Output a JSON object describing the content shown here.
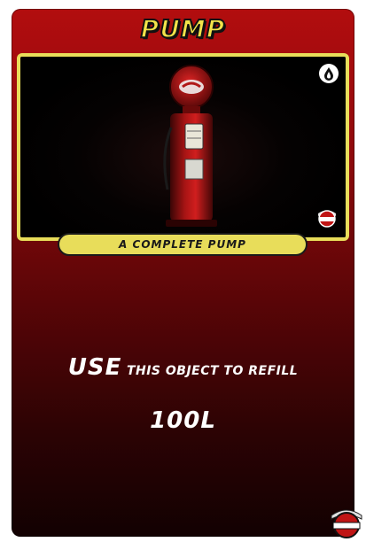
{
  "card": {
    "title": "PUMP",
    "caption": "A COMPLETE PUMP",
    "use_word": "USE",
    "use_rest": "THIS OBJECT TO REFILL",
    "amount": "100L"
  },
  "icons": {
    "top_right": "fuel-drop-icon",
    "image_logo": "world-logo-icon",
    "corner_logo": "world-logo-icon"
  },
  "colors": {
    "accent_yellow": "#e8dd5a",
    "card_red": "#b20d0e",
    "card_dark": "#120102"
  }
}
